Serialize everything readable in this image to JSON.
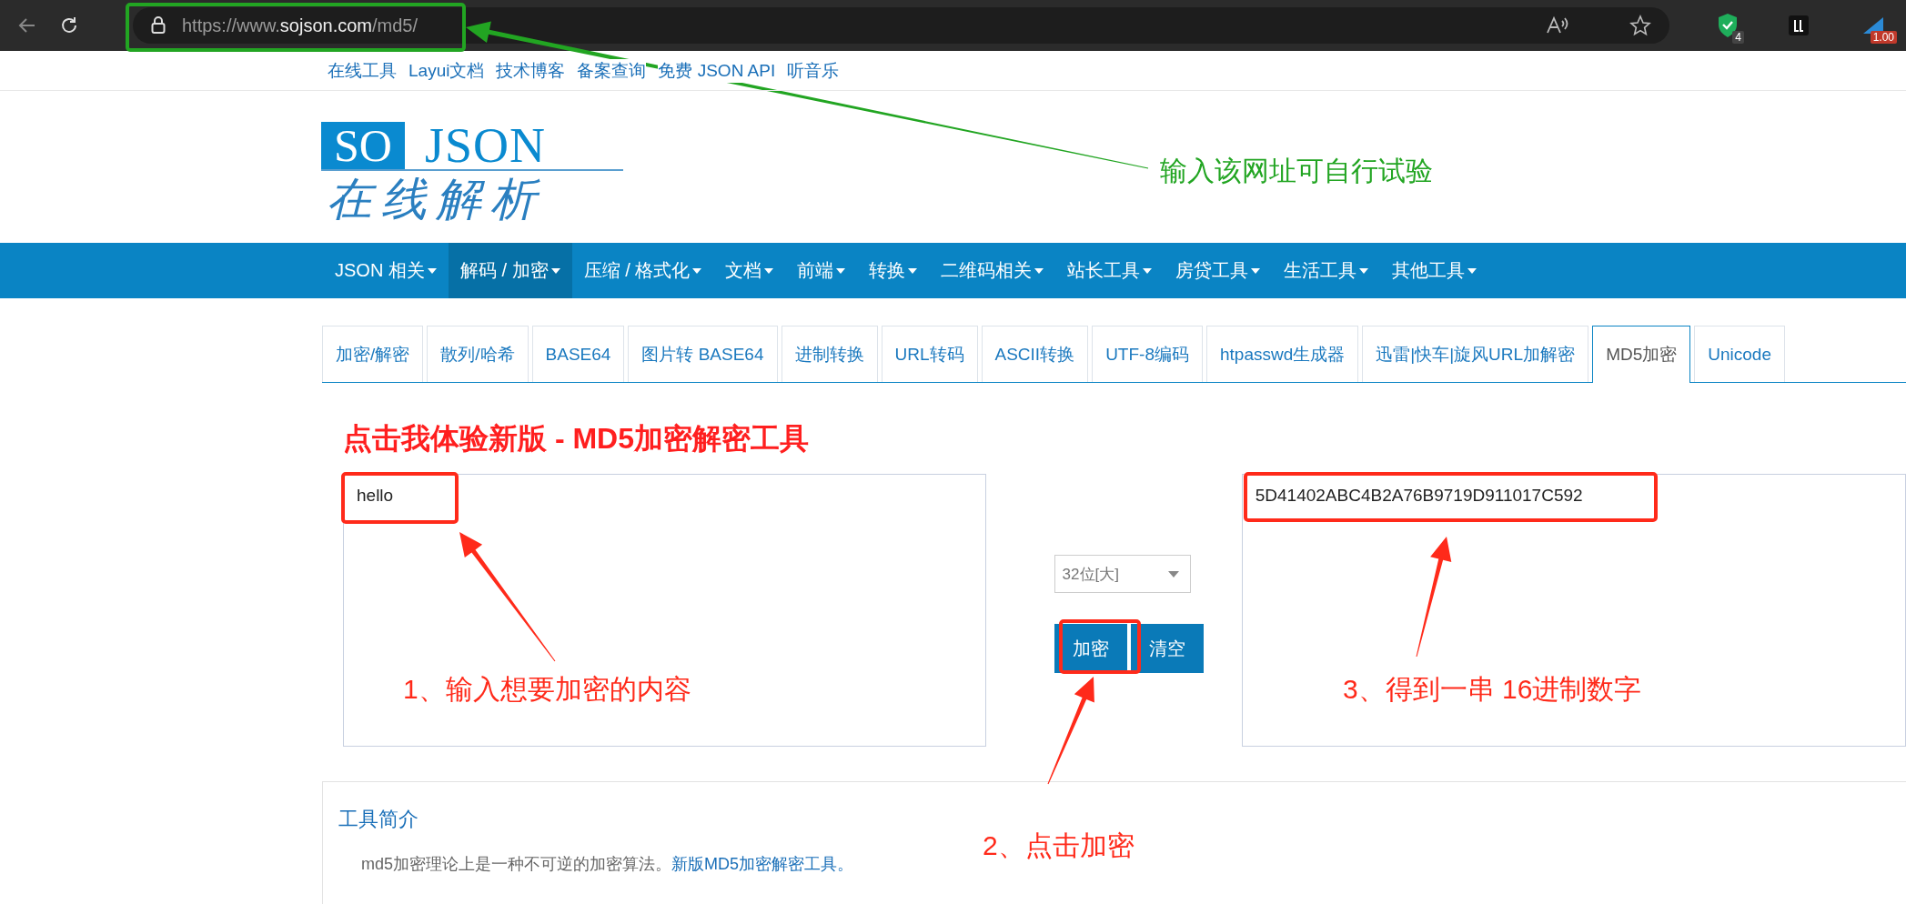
{
  "browser": {
    "url": "https://www.**sojson.com**/md5/",
    "shield_badge": "4",
    "extension_badge": "1.00"
  },
  "top_links": [
    "在线工具",
    "Layui文档",
    "技术博客",
    "备案查询",
    "免费 JSON API",
    "听音乐"
  ],
  "logo": {
    "boxed": "SO",
    "word": "JSON",
    "tagline": "在线解析"
  },
  "nav": [
    {
      "label": "JSON 相关",
      "selected": false
    },
    {
      "label": "解码 / 加密",
      "selected": true
    },
    {
      "label": "压缩 / 格式化",
      "selected": false
    },
    {
      "label": "文档",
      "selected": false
    },
    {
      "label": "前端",
      "selected": false
    },
    {
      "label": "转换",
      "selected": false
    },
    {
      "label": "二维码相关",
      "selected": false
    },
    {
      "label": "站长工具",
      "selected": false
    },
    {
      "label": "房贷工具",
      "selected": false
    },
    {
      "label": "生活工具",
      "selected": false
    },
    {
      "label": "其他工具",
      "selected": false
    }
  ],
  "tabs": [
    {
      "label": "加密/解密",
      "selected": false
    },
    {
      "label": "散列/哈希",
      "selected": false
    },
    {
      "label": "BASE64",
      "selected": false
    },
    {
      "label": "图片转 BASE64",
      "selected": false
    },
    {
      "label": "进制转换",
      "selected": false
    },
    {
      "label": "URL转码",
      "selected": false
    },
    {
      "label": "ASCII转换",
      "selected": false
    },
    {
      "label": "UTF-8编码",
      "selected": false
    },
    {
      "label": "htpasswd生成器",
      "selected": false
    },
    {
      "label": "迅雷|快车|旋风URL加解密",
      "selected": false
    },
    {
      "label": "MD5加密",
      "selected": true
    },
    {
      "label": "Unicode",
      "selected": false
    }
  ],
  "promo_link": "点击我体验新版 - MD5加密解密工具",
  "input": {
    "value": "hello"
  },
  "mode_select": {
    "value": "32位[大]"
  },
  "buttons": [
    "加密",
    "清空"
  ],
  "output": {
    "value": "5D41402ABC4B2A76B9719D911017C592"
  },
  "intro": {
    "title": "工具简介",
    "text": "md5加密理论上是一种不可逆的加密算法。",
    "link": "新版MD5加密解密工具。"
  },
  "annotations": [
    {
      "kind": "frame",
      "color": "#22a522"
    },
    {
      "kind": "arrow",
      "color": "#22a522"
    },
    {
      "kind": "note",
      "text": "输入该网址可自行试验",
      "color": "#22a522"
    },
    {
      "kind": "frame",
      "color": "#ff2a1a"
    },
    {
      "kind": "arrow",
      "color": "#ff2a1a"
    },
    {
      "kind": "note",
      "text": "1、输入想要加密的内容",
      "color": "#ff2a1a"
    },
    {
      "kind": "frame",
      "color": "#ff2a1a"
    },
    {
      "kind": "arrow",
      "color": "#ff2a1a"
    },
    {
      "kind": "note",
      "text": "2、点击加密",
      "color": "#ff2a1a"
    },
    {
      "kind": "frame",
      "color": "#ff2a1a"
    },
    {
      "kind": "arrow",
      "color": "#ff2a1a"
    },
    {
      "kind": "note",
      "text": "3、得到一串 16进制数字",
      "color": "#ff2a1a"
    }
  ]
}
